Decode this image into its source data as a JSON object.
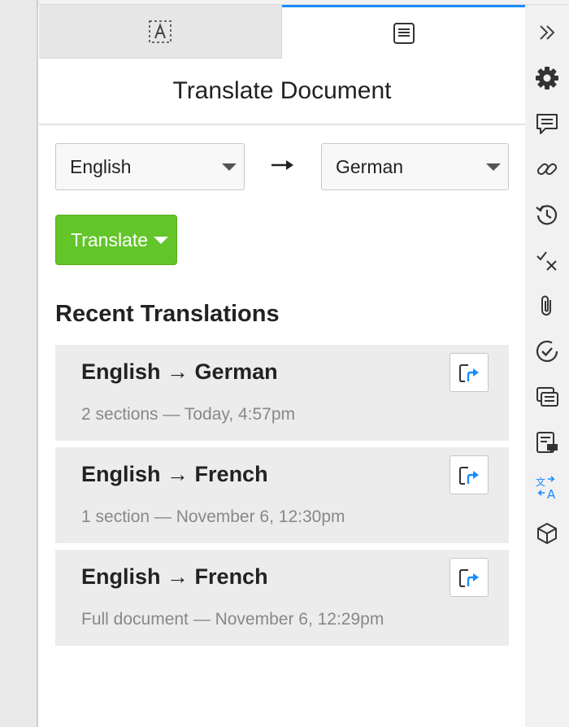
{
  "tabs": [
    {
      "name": "annotations",
      "icon": "text-select-icon",
      "active": false
    },
    {
      "name": "document",
      "icon": "document-lines-icon",
      "active": true
    }
  ],
  "panel": {
    "title": "Translate Document"
  },
  "languages": {
    "from": "English",
    "to": "German",
    "arrow": "→"
  },
  "translate_button": {
    "label": "Translate"
  },
  "recent": {
    "heading": "Recent Translations",
    "items": [
      {
        "from": "English",
        "arrow": "→",
        "to": "German",
        "details": "2 sections — Today, 4:57pm"
      },
      {
        "from": "English",
        "arrow": "→",
        "to": "French",
        "details": "1 section — November 6, 12:30pm"
      },
      {
        "from": "English",
        "arrow": "→",
        "to": "French",
        "details": "Full document — November 6, 12:29pm"
      }
    ]
  },
  "rail_icons": [
    "double-chevron-right-icon",
    "gear-icon",
    "comment-icon",
    "link-icon",
    "history-icon",
    "check-x-icon",
    "paperclip-icon",
    "check-circle-icon",
    "compare-docs-icon",
    "document-comment-icon",
    "translate-icon",
    "cube-icon"
  ],
  "colors": {
    "accent": "#1a8cff",
    "translate_button": "#63c52a",
    "card_background": "#ececec"
  }
}
